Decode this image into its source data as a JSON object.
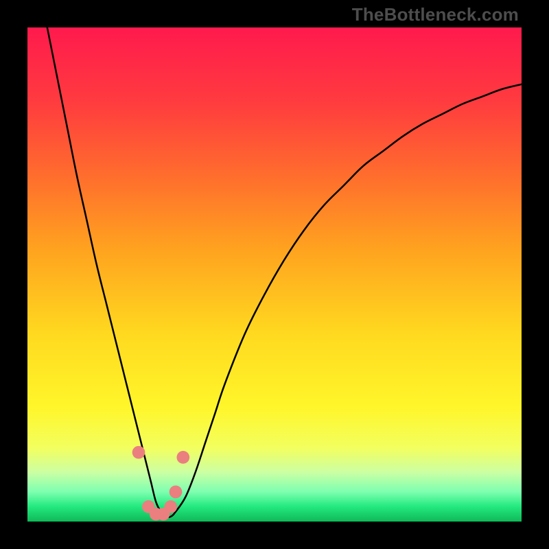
{
  "watermark": "TheBottleneck.com",
  "chart_data": {
    "type": "line",
    "title": "",
    "xlabel": "",
    "ylabel": "",
    "xlim": [
      0,
      100
    ],
    "ylim": [
      0,
      100
    ],
    "grid": false,
    "legend": false,
    "series": [
      {
        "name": "bottleneck-curve",
        "color": "#000000",
        "x": [
          4,
          6,
          8,
          10,
          12,
          14,
          16,
          18,
          20,
          22,
          23,
          24,
          25,
          26,
          27,
          28,
          29,
          30,
          32,
          34,
          36,
          38,
          40,
          44,
          48,
          52,
          56,
          60,
          64,
          68,
          72,
          76,
          80,
          84,
          88,
          92,
          96,
          100
        ],
        "y": [
          100,
          90,
          80,
          70,
          61,
          52,
          44,
          36,
          28,
          20,
          16,
          12,
          8,
          4,
          2,
          1,
          1,
          2,
          5,
          10,
          16,
          22,
          28,
          38,
          46,
          53,
          59,
          64,
          68,
          72,
          75,
          78,
          80.5,
          82.5,
          84.5,
          86,
          87.5,
          88.5
        ]
      }
    ],
    "markers": {
      "name": "highlight-dots",
      "color": "#eb7f7f",
      "radius": 1.3,
      "points": [
        {
          "x": 22.5,
          "y": 14
        },
        {
          "x": 24.5,
          "y": 3
        },
        {
          "x": 26.0,
          "y": 1.5
        },
        {
          "x": 27.5,
          "y": 1.5
        },
        {
          "x": 29.0,
          "y": 3
        },
        {
          "x": 30.0,
          "y": 6
        },
        {
          "x": 31.5,
          "y": 13
        }
      ]
    },
    "background_gradient": [
      {
        "offset": 0.0,
        "color": "#ff1a4d"
      },
      {
        "offset": 0.15,
        "color": "#ff3b3f"
      },
      {
        "offset": 0.3,
        "color": "#ff6d2d"
      },
      {
        "offset": 0.45,
        "color": "#ffa31f"
      },
      {
        "offset": 0.62,
        "color": "#ffd91f"
      },
      {
        "offset": 0.77,
        "color": "#fff62b"
      },
      {
        "offset": 0.85,
        "color": "#f3ff5e"
      },
      {
        "offset": 0.9,
        "color": "#ccffa3"
      },
      {
        "offset": 0.94,
        "color": "#7dffb0"
      },
      {
        "offset": 0.97,
        "color": "#22e97e"
      },
      {
        "offset": 1.0,
        "color": "#0fb858"
      }
    ]
  }
}
